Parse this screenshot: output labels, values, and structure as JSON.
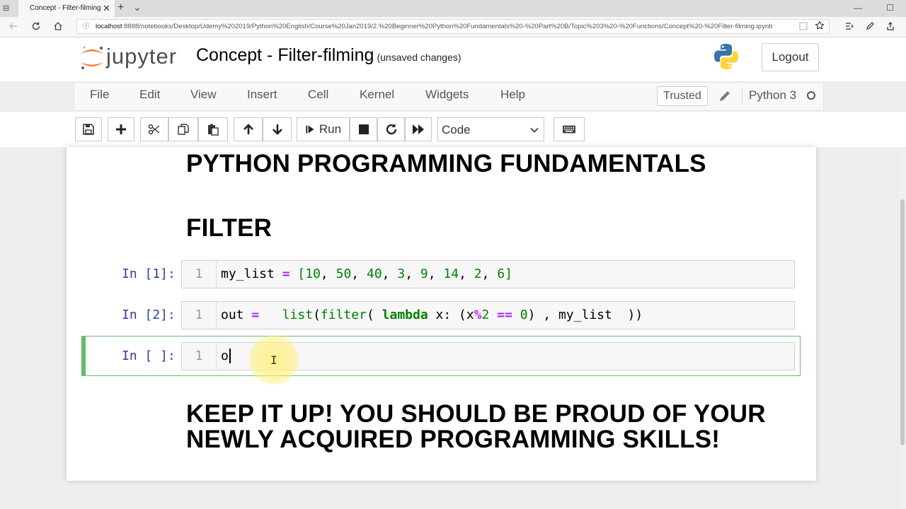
{
  "browser": {
    "tab_title": "Concept - Filter-filming",
    "tab_close": "✕",
    "new_tab": "+",
    "tab_list": "⌄",
    "minimize": "—",
    "maximize": "☐",
    "url_host": "localhost",
    "url_rest": ":8888/notebooks/Desktop/Udemy%202019/Python%20English/Course%20Jan2019/2.%20Beginner%20Python%20Fundamentals%20-%20Part%20B/Topic%203%20-%20Functions/Concept%20-%20Filter-filming.ipynb"
  },
  "header": {
    "logo_text": "jupyter",
    "notebook_name": "Concept - Filter-filming",
    "save_status": "(unsaved changes)",
    "logout_label": "Logout"
  },
  "menubar": {
    "items": [
      "File",
      "Edit",
      "View",
      "Insert",
      "Cell",
      "Kernel",
      "Widgets",
      "Help"
    ],
    "trusted_label": "Trusted",
    "kernel_name": "Python 3"
  },
  "toolbar": {
    "run_label": "Run",
    "cell_type": "Code"
  },
  "notebook": {
    "heading1": "PYTHON PROGRAMMING FUNDAMENTALS",
    "heading2": "FILTER",
    "heading3_line1": "KEEP IT UP! YOU SHOULD BE PROUD OF YOUR",
    "heading3_line2": "NEWLY ACQUIRED PROGRAMMING SKILLS!",
    "cells": [
      {
        "prompt": "In [1]:",
        "line_no": "1"
      },
      {
        "prompt": "In [2]:",
        "line_no": "1"
      },
      {
        "prompt": "In [ ]:",
        "line_no": "1",
        "text": "o"
      }
    ]
  },
  "colors": {
    "prompt": "#303f9f",
    "selected_border": "#66bb6a",
    "keyword": "#008000",
    "operator": "#aa22ff"
  }
}
